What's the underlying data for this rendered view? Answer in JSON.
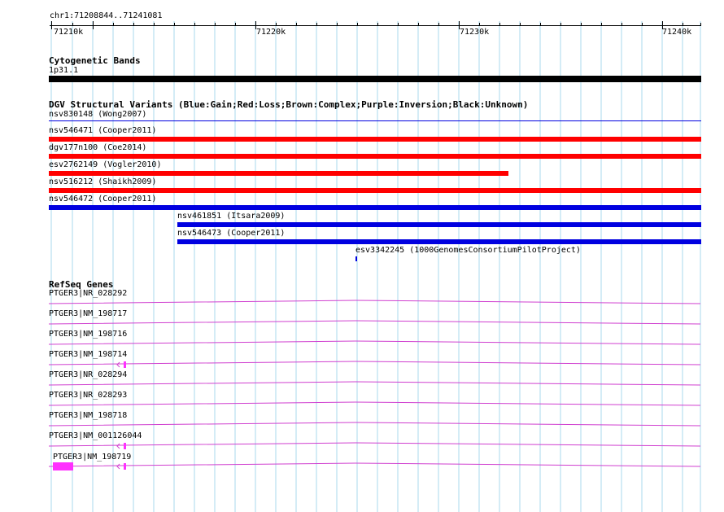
{
  "colors": {
    "grid": "#a8d8ec",
    "cyto_band": "#000000",
    "gain": "#0000e0",
    "loss": "#ff0000",
    "gene": "#d040d0",
    "exon": "#ff30ff"
  },
  "ruler": {
    "location": "chr1:71208844..71241081",
    "ticks": [
      "71210k",
      "71220k",
      "71230k",
      "71240k"
    ]
  },
  "cytobands": {
    "title": "Cytogenetic Bands",
    "band_label": "1p31.1"
  },
  "dgv": {
    "title": "DGV Structural Variants (Blue:Gain;Red:Loss;Brown:Complex;Purple:Inversion;Black:Unknown)",
    "variants": [
      {
        "label": "nsv830148 (Wong2007)",
        "type": "gain"
      },
      {
        "label": "nsv546471 (Cooper2011)",
        "type": "loss"
      },
      {
        "label": "dgv177n100 (Coe2014)",
        "type": "loss"
      },
      {
        "label": "esv2762149 (Vogler2010)",
        "type": "loss"
      },
      {
        "label": "nsv516212 (Shaikh2009)",
        "type": "loss"
      },
      {
        "label": "nsv546472 (Cooper2011)",
        "type": "gain"
      },
      {
        "label": "nsv461851 (Itsara2009)",
        "type": "gain"
      },
      {
        "label": "nsv546473 (Cooper2011)",
        "type": "gain"
      },
      {
        "label": "esv3342245 (1000GenomesConsortiumPilotProject)",
        "type": "gain"
      }
    ]
  },
  "refseq": {
    "title": "RefSeq Genes",
    "genes": [
      {
        "label": "PTGER3|NR_028292"
      },
      {
        "label": "PTGER3|NM_198717"
      },
      {
        "label": "PTGER3|NM_198716"
      },
      {
        "label": "PTGER3|NM_198714"
      },
      {
        "label": "PTGER3|NR_028294"
      },
      {
        "label": "PTGER3|NR_028293"
      },
      {
        "label": "PTGER3|NM_198718"
      },
      {
        "label": "PTGER3|NM_001126044"
      },
      {
        "label": "PTGER3|NM_198719"
      }
    ]
  }
}
